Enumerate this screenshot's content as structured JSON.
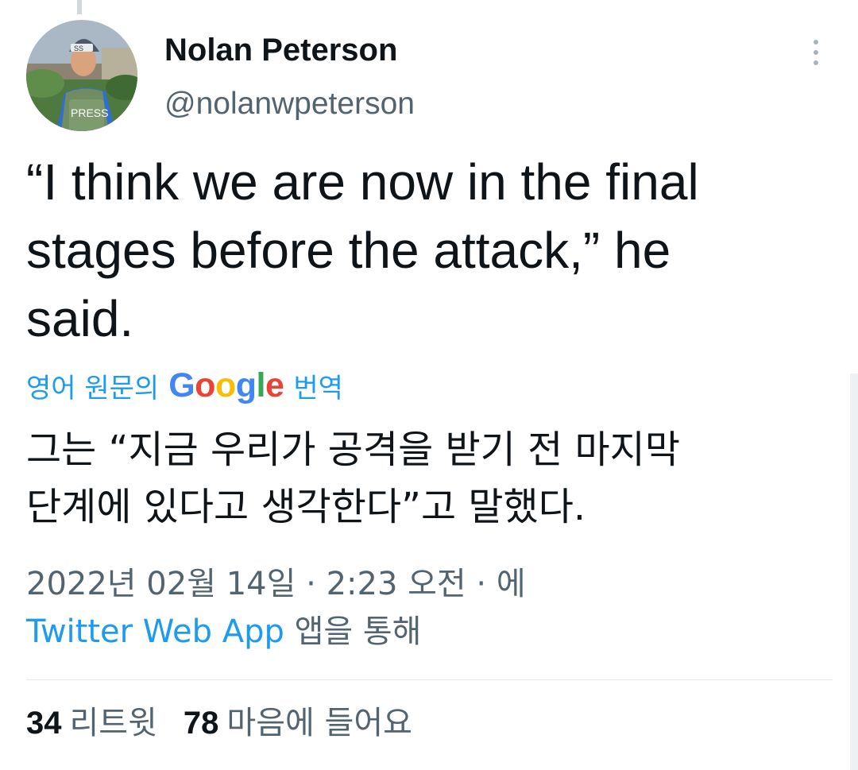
{
  "tweet": {
    "author_name": "Nolan Peterson",
    "author_handle": "@nolanwpeterson",
    "avatar_icon": "profile-photo-press-vest",
    "avatar_vest_text": "PRESS",
    "avatar_helmet_text": "SS",
    "more_icon": "vertical-ellipsis-icon",
    "text": "“I think we are now in the final\nstages before the attack,” he\nsaid.",
    "translation": {
      "label_prefix": "영어 원문의",
      "google_letters": [
        "G",
        "o",
        "o",
        "g",
        "l",
        "e"
      ],
      "google_colors": [
        "#4285f4",
        "#ea4335",
        "#fbbc05",
        "#4285f4",
        "#34a853",
        "#ea4335"
      ],
      "label_suffix": "번역",
      "text": "그는 “지금 우리가 공격을 받기 전 마지막\n단계에 있다고 생각한다”고 말했다."
    },
    "meta": {
      "date": "2022년 02월 14일 · 2:23 오전 · 에",
      "source_app": "Twitter Web App",
      "source_suffix": "앱을 통해"
    },
    "stats": {
      "retweets_count": "34",
      "retweets_label": "리트윗",
      "likes_count": "78",
      "likes_label": "마음에 들어요"
    }
  },
  "colors": {
    "text": "#0f1419",
    "secondary": "#536471",
    "link": "#1d9bf0",
    "divider": "#e4e9ec"
  }
}
